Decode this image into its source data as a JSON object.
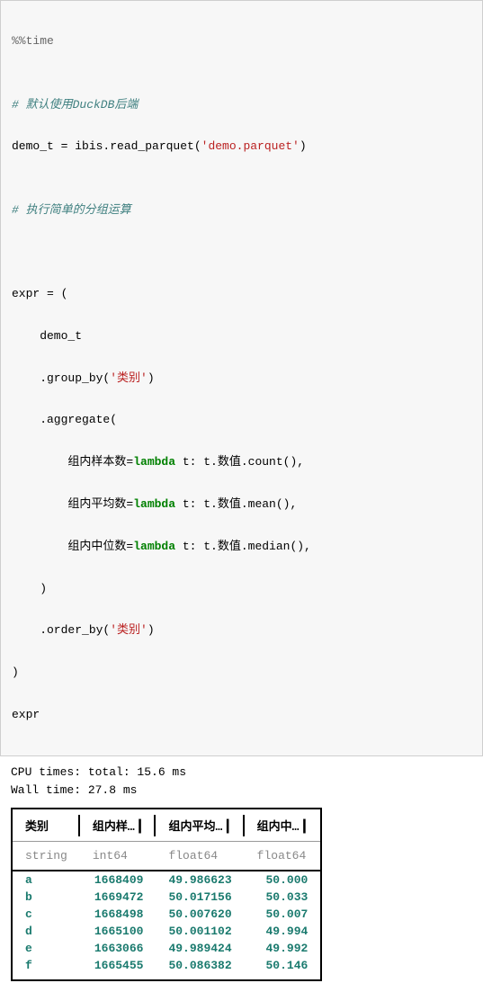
{
  "code": {
    "line1": "%%time",
    "line2": "",
    "line3": "# 默认使用DuckDB后端",
    "line4_text": "demo_t = ibis.read_parquet(",
    "line4_string": "'demo.parquet'",
    "line4_close": ")",
    "line5": "",
    "line6": "# 执行简单的分组运算",
    "line7": "",
    "line8": "",
    "line9": "expr = (",
    "line10": "    demo_t",
    "line11_text": "    .group_by(",
    "line11_string": "'类别'",
    "line11_close": ")",
    "line12": "    .aggregate(",
    "line13_label": "        组内样本数=",
    "line13_lambda": "lambda",
    "line13_rest": " t: t.数值.count(),",
    "line14_label": "        组内平均数=",
    "line14_lambda": "lambda",
    "line14_rest": " t: t.数值.mean(),",
    "line15_label": "        组内中位数=",
    "line15_lambda": "lambda",
    "line15_rest": " t: t.数值.median(),",
    "line16": "    )",
    "line17_text": "    .order_by(",
    "line17_string": "'类别'",
    "line17_close": ")",
    "line18": ")",
    "line19": "expr"
  },
  "output": {
    "cpu_times": "CPU times: total: 15.6 ms",
    "wall_time": "Wall time: 27.8 ms"
  },
  "table": {
    "headers": {
      "col1": "类别",
      "col2": "组内样…",
      "col3": "组内平均…",
      "col4": "组内中…"
    },
    "types": {
      "col1": "string",
      "col2": "int64",
      "col3": "float64",
      "col4": "float64"
    },
    "rows": [
      {
        "c1": "a",
        "c2": "1668409",
        "c3": "49.986623",
        "c4": "50.000"
      },
      {
        "c1": "b",
        "c2": "1669472",
        "c3": "50.017156",
        "c4": "50.033"
      },
      {
        "c1": "c",
        "c2": "1668498",
        "c3": "50.007620",
        "c4": "50.007"
      },
      {
        "c1": "d",
        "c2": "1665100",
        "c3": "50.001102",
        "c4": "49.994"
      },
      {
        "c1": "e",
        "c2": "1663066",
        "c3": "49.989424",
        "c4": "49.992"
      },
      {
        "c1": "f",
        "c2": "1665455",
        "c3": "50.086382",
        "c4": "50.146"
      }
    ]
  },
  "chart_data": {
    "type": "table",
    "columns": [
      "类别",
      "组内样本数",
      "组内平均数",
      "组内中位数"
    ],
    "column_types": [
      "string",
      "int64",
      "float64",
      "float64"
    ],
    "rows": [
      [
        "a",
        1668409,
        49.986623,
        50.0
      ],
      [
        "b",
        1669472,
        50.017156,
        50.033
      ],
      [
        "c",
        1668498,
        50.00762,
        50.007
      ],
      [
        "d",
        1665100,
        50.001102,
        49.994
      ],
      [
        "e",
        1663066,
        49.989424,
        49.992
      ],
      [
        "f",
        1665455,
        50.086382,
        50.146
      ]
    ]
  }
}
